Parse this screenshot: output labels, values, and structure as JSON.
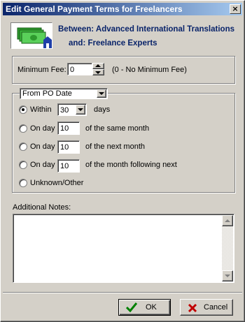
{
  "window": {
    "title": "Edit General Payment Terms for Freelancers",
    "close_glyph": "×"
  },
  "header": {
    "icon": "money-icon",
    "between_text": "Between: Advanced International Translations",
    "and_text": "and:  Freelance Experts"
  },
  "minimum_fee": {
    "label": "Minimum Fee:",
    "value": "0",
    "hint": "(0 - No Minimum Fee)"
  },
  "terms": {
    "date_basis": "From PO Date",
    "options": [
      {
        "label": "Within",
        "value": "30",
        "suffix": "days",
        "selected": true
      },
      {
        "label": "On day",
        "value": "10",
        "suffix": "of the same month",
        "selected": false
      },
      {
        "label": "On day",
        "value": "10",
        "suffix": "of the next month",
        "selected": false
      },
      {
        "label": "On day",
        "value": "10",
        "suffix": "of the month following next",
        "selected": false
      },
      {
        "label": "Unknown/Other",
        "selected": false
      }
    ]
  },
  "notes": {
    "label": "Additional Notes:",
    "value": ""
  },
  "buttons": {
    "ok": "OK",
    "cancel": "Cancel"
  },
  "colors": {
    "title_bar": "#0a246a",
    "header_text": "#0a246a",
    "window_bg": "#d4d0c8",
    "ok_check": "#008000",
    "cancel_x": "#c00000"
  }
}
